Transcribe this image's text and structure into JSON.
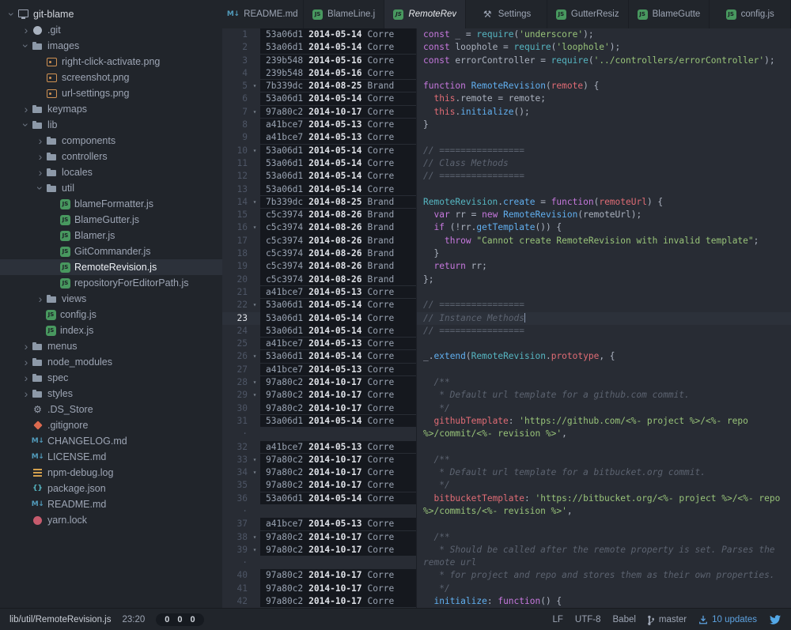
{
  "colors": {
    "editor_bg": "#282c34",
    "panel_bg": "#21252b",
    "selection_bg": "#2c313a",
    "blame_bg": "#15181e",
    "accent_blue": "#61afef",
    "update_blue": "#5da2e0",
    "keyword": "#c678dd",
    "string": "#98c379",
    "comment": "#5c6370",
    "func": "#61afef"
  },
  "icons": {
    "glyphs": {
      "markdown": "M↓",
      "gear": "⚙",
      "settings": "⚒",
      "json": "{}",
      "js": "JS"
    }
  },
  "sidebar": {
    "items": [
      {
        "label": "git-blame",
        "depth": 0,
        "icon": "repo",
        "chev": "down",
        "root": true
      },
      {
        "label": ".git",
        "depth": 1,
        "icon": "github",
        "chev": "right"
      },
      {
        "label": "images",
        "depth": 1,
        "icon": "folder",
        "chev": "down"
      },
      {
        "label": "right-click-activate.png",
        "depth": 2,
        "icon": "image"
      },
      {
        "label": "screenshot.png",
        "depth": 2,
        "icon": "image"
      },
      {
        "label": "url-settings.png",
        "depth": 2,
        "icon": "image"
      },
      {
        "label": "keymaps",
        "depth": 1,
        "icon": "folder",
        "chev": "right"
      },
      {
        "label": "lib",
        "depth": 1,
        "icon": "folder",
        "chev": "down"
      },
      {
        "label": "components",
        "depth": 2,
        "icon": "folder",
        "chev": "right"
      },
      {
        "label": "controllers",
        "depth": 2,
        "icon": "folder",
        "chev": "right"
      },
      {
        "label": "locales",
        "depth": 2,
        "icon": "folder",
        "chev": "right"
      },
      {
        "label": "util",
        "depth": 2,
        "icon": "folder",
        "chev": "down"
      },
      {
        "label": "blameFormatter.js",
        "depth": 3,
        "icon": "js"
      },
      {
        "label": "BlameGutter.js",
        "depth": 3,
        "icon": "js"
      },
      {
        "label": "Blamer.js",
        "depth": 3,
        "icon": "js"
      },
      {
        "label": "GitCommander.js",
        "depth": 3,
        "icon": "js"
      },
      {
        "label": "RemoteRevision.js",
        "depth": 3,
        "icon": "js",
        "selected": true
      },
      {
        "label": "repositoryForEditorPath.js",
        "depth": 3,
        "icon": "js"
      },
      {
        "label": "views",
        "depth": 2,
        "icon": "folder",
        "chev": "right"
      },
      {
        "label": "config.js",
        "depth": 2,
        "icon": "js"
      },
      {
        "label": "index.js",
        "depth": 2,
        "icon": "js"
      },
      {
        "label": "menus",
        "depth": 1,
        "icon": "folder",
        "chev": "right"
      },
      {
        "label": "node_modules",
        "depth": 1,
        "icon": "folder",
        "chev": "right"
      },
      {
        "label": "spec",
        "depth": 1,
        "icon": "folder",
        "chev": "right"
      },
      {
        "label": "styles",
        "depth": 1,
        "icon": "folder",
        "chev": "right"
      },
      {
        "label": ".DS_Store",
        "depth": 1,
        "icon": "gear"
      },
      {
        "label": ".gitignore",
        "depth": 1,
        "icon": "git"
      },
      {
        "label": "CHANGELOG.md",
        "depth": 1,
        "icon": "markdown"
      },
      {
        "label": "LICENSE.md",
        "depth": 1,
        "icon": "markdown"
      },
      {
        "label": "npm-debug.log",
        "depth": 1,
        "icon": "npm"
      },
      {
        "label": "package.json",
        "depth": 1,
        "icon": "json"
      },
      {
        "label": "README.md",
        "depth": 1,
        "icon": "markdown"
      },
      {
        "label": "yarn.lock",
        "depth": 1,
        "icon": "yarn"
      }
    ]
  },
  "tabs": [
    {
      "label": "README.md",
      "icon": "markdown",
      "active": false
    },
    {
      "label": "BlameLine.j",
      "icon": "js",
      "active": false
    },
    {
      "label": "RemoteRev",
      "icon": "js",
      "active": true
    },
    {
      "label": "Settings",
      "icon": "settings",
      "active": false
    },
    {
      "label": "GutterResiz",
      "icon": "js",
      "active": false
    },
    {
      "label": "BlameGutte",
      "icon": "js",
      "active": false
    },
    {
      "label": "config.js",
      "icon": "js",
      "active": false
    }
  ],
  "editor": {
    "rows": [
      {
        "num": "1",
        "hash": "53a06d1",
        "date": "2014-05-14",
        "author": "Corre",
        "code": [
          [
            "k",
            "const"
          ],
          [
            "d",
            " _ = "
          ],
          [
            "y",
            "require"
          ],
          [
            "d",
            "("
          ],
          [
            "s",
            "'underscore'"
          ],
          [
            "d",
            ");"
          ]
        ]
      },
      {
        "num": "2",
        "hash": "53a06d1",
        "date": "2014-05-14",
        "author": "Corre",
        "code": [
          [
            "k",
            "const"
          ],
          [
            "d",
            " loophole = "
          ],
          [
            "y",
            "require"
          ],
          [
            "d",
            "("
          ],
          [
            "s",
            "'loophole'"
          ],
          [
            "d",
            ");"
          ]
        ]
      },
      {
        "num": "3",
        "hash": "239b548",
        "date": "2014-05-16",
        "author": "Corre",
        "code": [
          [
            "k",
            "const"
          ],
          [
            "d",
            " errorController = "
          ],
          [
            "y",
            "require"
          ],
          [
            "d",
            "("
          ],
          [
            "s",
            "'../controllers/errorController'"
          ],
          [
            "d",
            ");"
          ]
        ]
      },
      {
        "num": "4",
        "hash": "239b548",
        "date": "2014-05-16",
        "author": "Corre",
        "code": []
      },
      {
        "num": "5",
        "chev": true,
        "hash": "7b339dc",
        "date": "2014-08-25",
        "author": "Brand",
        "code": [
          [
            "k",
            "function"
          ],
          [
            "d",
            " "
          ],
          [
            "f",
            "RemoteRevision"
          ],
          [
            "d",
            "("
          ],
          [
            "r",
            "remote"
          ],
          [
            "d",
            ") {"
          ]
        ]
      },
      {
        "num": "6",
        "hash": "53a06d1",
        "date": "2014-05-14",
        "author": "Corre",
        "code": [
          [
            "d",
            "  "
          ],
          [
            "r",
            "this"
          ],
          [
            "d",
            ".remote = remote;"
          ]
        ]
      },
      {
        "num": "7",
        "chev": true,
        "hash": "97a80c2",
        "date": "2014-10-17",
        "author": "Corre",
        "code": [
          [
            "d",
            "  "
          ],
          [
            "r",
            "this"
          ],
          [
            "d",
            "."
          ],
          [
            "f",
            "initialize"
          ],
          [
            "d",
            "();"
          ]
        ]
      },
      {
        "num": "8",
        "hash": "a41bce7",
        "date": "2014-05-13",
        "author": "Corre",
        "code": [
          [
            "d",
            "}"
          ]
        ]
      },
      {
        "num": "9",
        "hash": "a41bce7",
        "date": "2014-05-13",
        "author": "Corre",
        "code": []
      },
      {
        "num": "10",
        "chev": true,
        "hash": "53a06d1",
        "date": "2014-05-14",
        "author": "Corre",
        "code": [
          [
            "c",
            "// ================"
          ]
        ]
      },
      {
        "num": "11",
        "hash": "53a06d1",
        "date": "2014-05-14",
        "author": "Corre",
        "code": [
          [
            "c",
            "// Class Methods"
          ]
        ]
      },
      {
        "num": "12",
        "hash": "53a06d1",
        "date": "2014-05-14",
        "author": "Corre",
        "code": [
          [
            "c",
            "// ================"
          ]
        ]
      },
      {
        "num": "13",
        "hash": "53a06d1",
        "date": "2014-05-14",
        "author": "Corre",
        "code": []
      },
      {
        "num": "14",
        "chev": true,
        "hash": "7b339dc",
        "date": "2014-08-25",
        "author": "Brand",
        "code": [
          [
            "y",
            "RemoteRevision"
          ],
          [
            "d",
            "."
          ],
          [
            "f",
            "create"
          ],
          [
            "d",
            " = "
          ],
          [
            "k",
            "function"
          ],
          [
            "d",
            "("
          ],
          [
            "r",
            "remoteUrl"
          ],
          [
            "d",
            ") {"
          ]
        ]
      },
      {
        "num": "15",
        "hash": "c5c3974",
        "date": "2014-08-26",
        "author": "Brand",
        "code": [
          [
            "d",
            "  "
          ],
          [
            "k",
            "var"
          ],
          [
            "d",
            " rr = "
          ],
          [
            "k",
            "new"
          ],
          [
            "d",
            " "
          ],
          [
            "f",
            "RemoteRevision"
          ],
          [
            "d",
            "(remoteUrl);"
          ]
        ]
      },
      {
        "num": "16",
        "chev": true,
        "hash": "c5c3974",
        "date": "2014-08-26",
        "author": "Brand",
        "code": [
          [
            "d",
            "  "
          ],
          [
            "k",
            "if"
          ],
          [
            "d",
            " (!rr."
          ],
          [
            "f",
            "getTemplate"
          ],
          [
            "d",
            "()) {"
          ]
        ]
      },
      {
        "num": "17",
        "hash": "c5c3974",
        "date": "2014-08-26",
        "author": "Brand",
        "code": [
          [
            "d",
            "    "
          ],
          [
            "k",
            "throw"
          ],
          [
            "d",
            " "
          ],
          [
            "s",
            "\"Cannot create RemoteRevision with invalid template\""
          ],
          [
            "d",
            ";"
          ]
        ]
      },
      {
        "num": "18",
        "hash": "c5c3974",
        "date": "2014-08-26",
        "author": "Brand",
        "code": [
          [
            "d",
            "  }"
          ]
        ]
      },
      {
        "num": "19",
        "hash": "c5c3974",
        "date": "2014-08-26",
        "author": "Brand",
        "code": [
          [
            "d",
            "  "
          ],
          [
            "k",
            "return"
          ],
          [
            "d",
            " rr;"
          ]
        ]
      },
      {
        "num": "20",
        "hash": "c5c3974",
        "date": "2014-08-26",
        "author": "Brand",
        "code": [
          [
            "d",
            "};"
          ]
        ]
      },
      {
        "num": "21",
        "hash": "a41bce7",
        "date": "2014-05-13",
        "author": "Corre",
        "code": []
      },
      {
        "num": "22",
        "chev": true,
        "hash": "53a06d1",
        "date": "2014-05-14",
        "author": "Corre",
        "code": [
          [
            "c",
            "// ================"
          ]
        ]
      },
      {
        "num": "23",
        "cur": true,
        "hash": "53a06d1",
        "date": "2014-05-14",
        "author": "Corre",
        "code": [
          [
            "c",
            "// Instance Methods"
          ]
        ]
      },
      {
        "num": "24",
        "hash": "53a06d1",
        "date": "2014-05-14",
        "author": "Corre",
        "code": [
          [
            "c",
            "// ================"
          ]
        ]
      },
      {
        "num": "25",
        "hash": "a41bce7",
        "date": "2014-05-13",
        "author": "Corre",
        "code": []
      },
      {
        "num": "26",
        "chev": true,
        "hash": "53a06d1",
        "date": "2014-05-14",
        "author": "Corre",
        "code": [
          [
            "d",
            "_."
          ],
          [
            "f",
            "extend"
          ],
          [
            "d",
            "("
          ],
          [
            "y",
            "RemoteRevision"
          ],
          [
            "d",
            "."
          ],
          [
            "r",
            "prototype"
          ],
          [
            "d",
            ", {"
          ]
        ]
      },
      {
        "num": "27",
        "hash": "a41bce7",
        "date": "2014-05-13",
        "author": "Corre",
        "code": []
      },
      {
        "num": "28",
        "chev": true,
        "hash": "97a80c2",
        "date": "2014-10-17",
        "author": "Corre",
        "code": [
          [
            "c",
            "  /**"
          ]
        ]
      },
      {
        "num": "29",
        "chev": true,
        "hash": "97a80c2",
        "date": "2014-10-17",
        "author": "Corre",
        "code": [
          [
            "c",
            "   * Default url template for a github.com commit."
          ]
        ]
      },
      {
        "num": "30",
        "hash": "97a80c2",
        "date": "2014-10-17",
        "author": "Corre",
        "code": [
          [
            "c",
            "   */"
          ]
        ]
      },
      {
        "num": "31",
        "hash": "53a06d1",
        "date": "2014-05-14",
        "author": "Corre",
        "code": [
          [
            "d",
            "  "
          ],
          [
            "r",
            "githubTemplate"
          ],
          [
            "d",
            ": "
          ],
          [
            "s",
            "'https://github.com/<%- project %>/<%- repo"
          ]
        ]
      },
      {
        "wrap": true,
        "code": [
          [
            "s",
            "%>/commit/<%- revision %>'"
          ],
          [
            "d",
            ","
          ]
        ]
      },
      {
        "num": "32",
        "hash": "a41bce7",
        "date": "2014-05-13",
        "author": "Corre",
        "code": []
      },
      {
        "num": "33",
        "chev": true,
        "hash": "97a80c2",
        "date": "2014-10-17",
        "author": "Corre",
        "code": [
          [
            "c",
            "  /**"
          ]
        ]
      },
      {
        "num": "34",
        "chev": true,
        "hash": "97a80c2",
        "date": "2014-10-17",
        "author": "Corre",
        "code": [
          [
            "c",
            "   * Default url template for a bitbucket.org commit."
          ]
        ]
      },
      {
        "num": "35",
        "hash": "97a80c2",
        "date": "2014-10-17",
        "author": "Corre",
        "code": [
          [
            "c",
            "   */"
          ]
        ]
      },
      {
        "num": "36",
        "hash": "53a06d1",
        "date": "2014-05-14",
        "author": "Corre",
        "code": [
          [
            "d",
            "  "
          ],
          [
            "r",
            "bitbucketTemplate"
          ],
          [
            "d",
            ": "
          ],
          [
            "s",
            "'https://bitbucket.org/<%- project %>/<%- repo"
          ]
        ]
      },
      {
        "wrap": true,
        "code": [
          [
            "s",
            "%>/commits/<%- revision %>'"
          ],
          [
            "d",
            ","
          ]
        ]
      },
      {
        "num": "37",
        "hash": "a41bce7",
        "date": "2014-05-13",
        "author": "Corre",
        "code": []
      },
      {
        "num": "38",
        "chev": true,
        "hash": "97a80c2",
        "date": "2014-10-17",
        "author": "Corre",
        "code": [
          [
            "c",
            "  /**"
          ]
        ]
      },
      {
        "num": "39",
        "chev": true,
        "hash": "97a80c2",
        "date": "2014-10-17",
        "author": "Corre",
        "code": [
          [
            "c",
            "   * Should be called after the remote property is set. Parses the"
          ]
        ]
      },
      {
        "wrap": true,
        "code": [
          [
            "c",
            "remote url"
          ]
        ]
      },
      {
        "num": "40",
        "hash": "97a80c2",
        "date": "2014-10-17",
        "author": "Corre",
        "code": [
          [
            "c",
            "   * for project and repo and stores them as their own properties."
          ]
        ]
      },
      {
        "num": "41",
        "hash": "97a80c2",
        "date": "2014-10-17",
        "author": "Corre",
        "code": [
          [
            "c",
            "   */"
          ]
        ]
      },
      {
        "num": "42",
        "hash": "97a80c2",
        "date": "2014-10-17",
        "author": "Corre",
        "code": [
          [
            "d",
            "  "
          ],
          [
            "f",
            "initialize"
          ],
          [
            "d",
            ": "
          ],
          [
            "k",
            "function"
          ],
          [
            "d",
            "() {"
          ]
        ]
      }
    ]
  },
  "status": {
    "path": "lib/util/RemoteRevision.js",
    "cursor_position": "23:20",
    "git_counts": [
      "0",
      "0",
      "0"
    ],
    "line_ending": "LF",
    "encoding": "UTF-8",
    "grammar": "Babel",
    "branch": "master",
    "updates": "10 updates"
  }
}
